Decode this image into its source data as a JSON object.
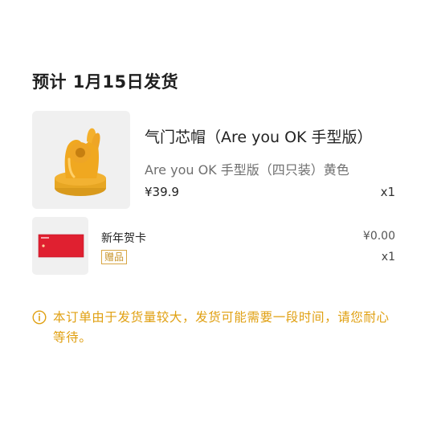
{
  "shipping": {
    "title": "预计 1月15日发货"
  },
  "product": {
    "name": "气门芯帽（Are you OK 手型版）",
    "variant": "Are you OK 手型版（四只装）黄色",
    "price": "¥39.9",
    "quantity": "x1",
    "image_icon": "hand-ok-figurine"
  },
  "gift": {
    "name": "新年贺卡",
    "badge": "赠品",
    "price": "¥0.00",
    "quantity": "x1",
    "image_icon": "red-greeting-card"
  },
  "notice": {
    "icon": "info-icon",
    "text": "本订单由于发货量较大，发货可能需要一段时间，请您耐心等待。",
    "color": "#e0a012"
  },
  "colors": {
    "accent": "#e0a012",
    "badge": "#c8952c",
    "card_red": "#e02030",
    "figurine": "#f0a820"
  }
}
